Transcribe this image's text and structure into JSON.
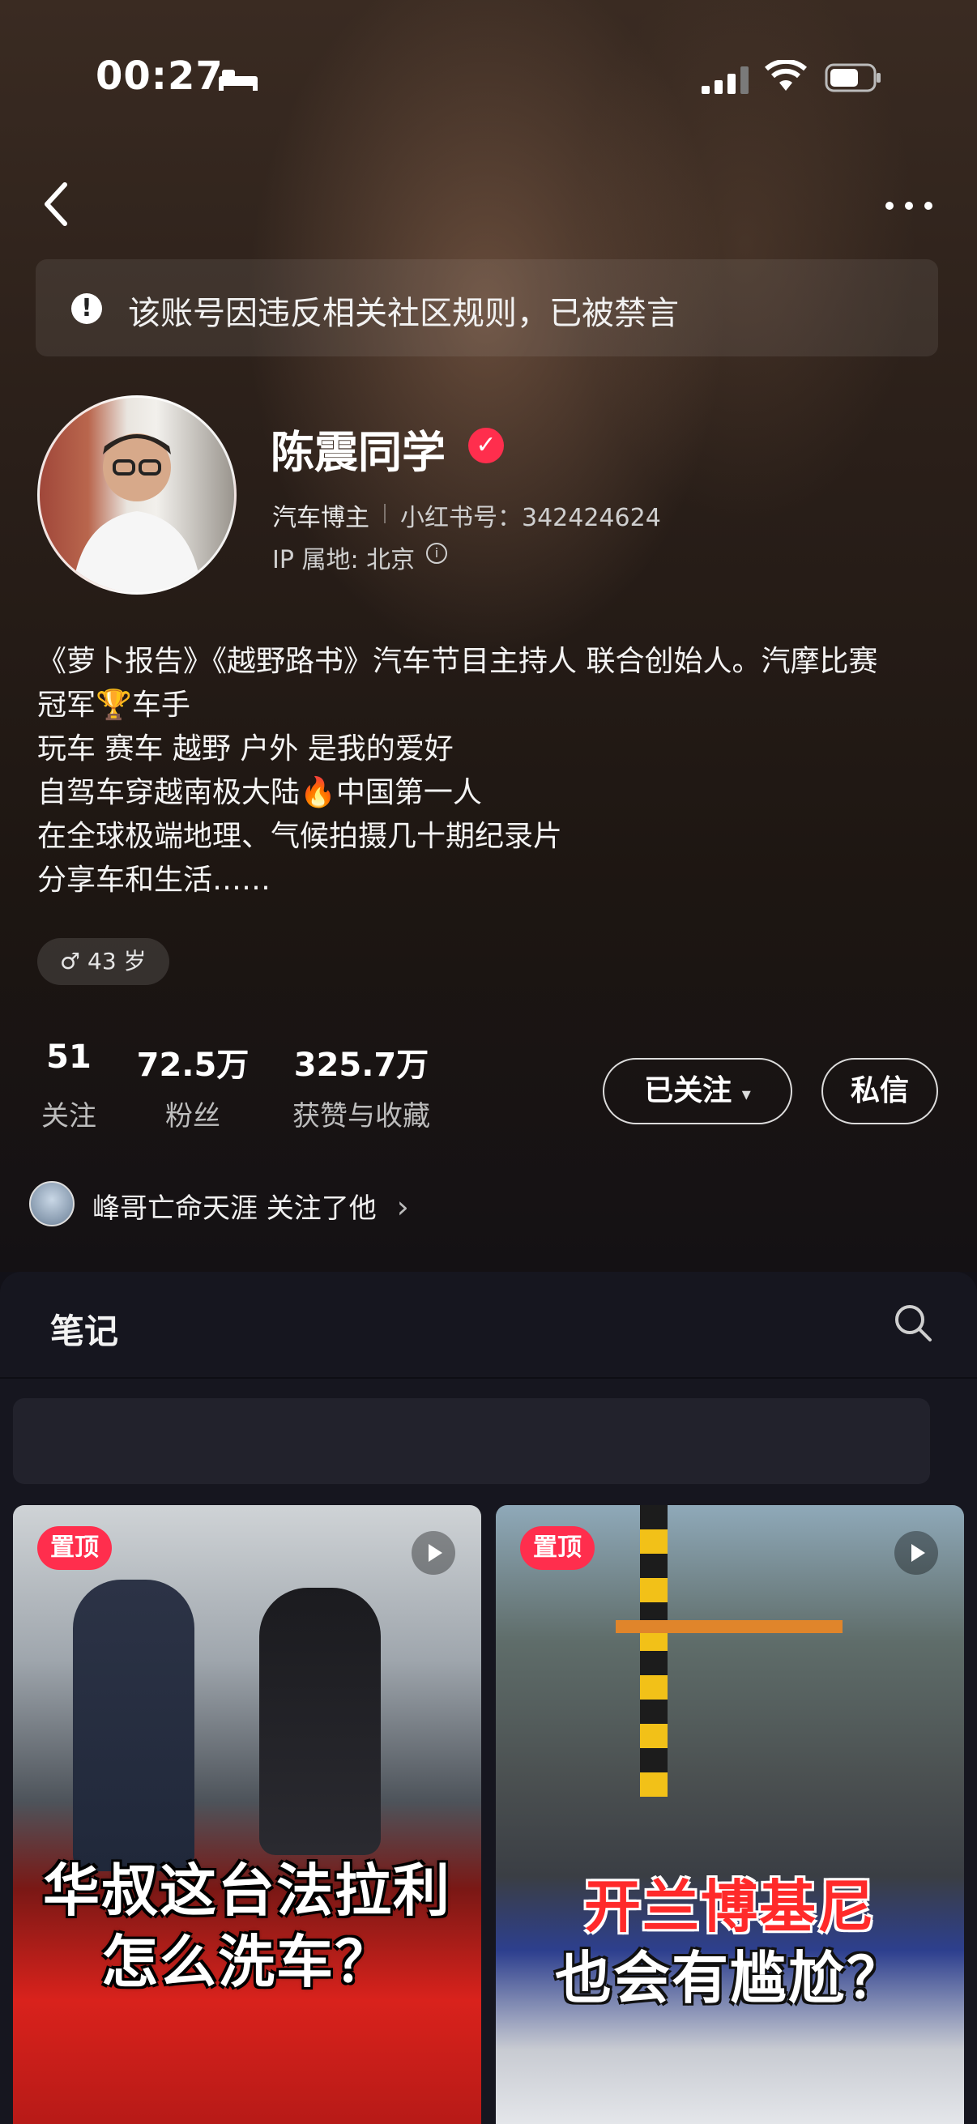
{
  "status_bar": {
    "time": "00:27"
  },
  "notice": {
    "text": "该账号因违反相关社区规则，已被禁言"
  },
  "profile": {
    "name": "陈震同学",
    "role": "汽车博主",
    "id_label": "小红书号：342424624",
    "ip": "IP 属地: 北京",
    "bio": [
      "《萝卜报告》《越野路书》汽车节目主持人 联合创始人。汽摩比赛",
      "冠军🏆车手",
      "玩车 赛车 越野 户外 是我的爱好",
      "自驾车穿越南极大陆🔥中国第一人",
      "在全球极端地理、气候拍摄几十期纪录片",
      "分享车和生活……"
    ],
    "age_tag": "♂ 43 岁"
  },
  "stats": [
    {
      "value": "51",
      "label": "关注"
    },
    {
      "value": "72.5万",
      "label": "粉丝"
    },
    {
      "value": "325.7万",
      "label": "获赞与收藏"
    }
  ],
  "actions": {
    "follow": "已关注",
    "follow_caret": "▾",
    "message": "私信"
  },
  "mutual": {
    "text": "峰哥亡命天涯 关注了他",
    "chevron": "›"
  },
  "tabs": {
    "notes": "笔记"
  },
  "posts": [
    {
      "pin": "置顶",
      "caption_lines": [
        "华叔这台法拉利",
        "怎么洗车？"
      ]
    },
    {
      "pin": "置顶",
      "caption_lines": [
        "开兰博基尼",
        "也会有尴尬？"
      ]
    }
  ],
  "colors": {
    "accent": "#ff2e4d",
    "panel": "#16161f"
  }
}
